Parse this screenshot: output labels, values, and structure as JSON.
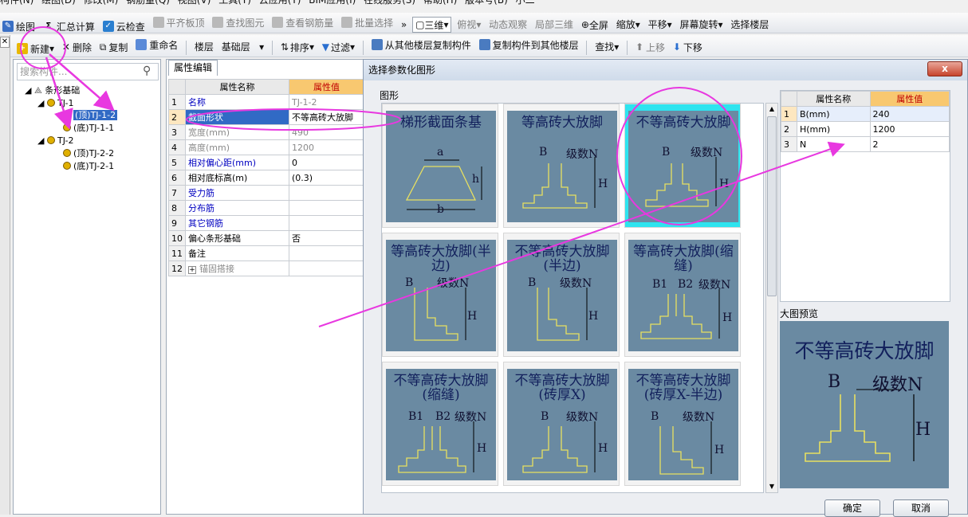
{
  "menubar": [
    "构件(N)",
    "绘图(D)",
    "修改(M)",
    "钢筋量(Q)",
    "视图(V)",
    "工具(T)",
    "云应用(Y)",
    "BIM应用(I)",
    "在线服务(S)",
    "帮助(H)",
    "版本号(B)",
    "小二"
  ],
  "toolbar1": {
    "draw": "绘图",
    "sum": "汇总计算",
    "cloud": "云检查",
    "flat": "平齐板顶",
    "find": "查找图元",
    "viewrebar": "查看钢筋量",
    "batch": "批量选择",
    "view3d": "三维",
    "top": "俯视",
    "dynamic": "动态观察",
    "local3d": "局部三维",
    "full": "全屏",
    "zoom": "缩放",
    "pan": "平移",
    "rotate": "屏幕旋转",
    "floor": "选择楼层"
  },
  "toolbar2": {
    "new": "新建",
    "delete": "删除",
    "copy": "复制",
    "rename": "重命名",
    "floor_label": "楼层",
    "floor_value": "基础层",
    "sort": "排序",
    "filter": "过滤",
    "copy_from": "从其他楼层复制构件",
    "copy_to": "复制构件到其他楼层",
    "find": "查找",
    "up": "上移",
    "down": "下移"
  },
  "tree": {
    "search_placeholder": "搜索构件...",
    "root": "条形基础",
    "n1": "TJ-1",
    "n1a": "(顶)TJ-1-2",
    "n1b": "(底)TJ-1-1",
    "n2": "TJ-2",
    "n2a": "(顶)TJ-2-2",
    "n2b": "(底)TJ-2-1"
  },
  "props": {
    "tab": "属性编辑",
    "col_name": "属性名称",
    "col_value": "属性值",
    "rows": [
      {
        "n": "1",
        "name": "名称",
        "value": "TJ-1-2"
      },
      {
        "n": "2",
        "name": "截面形状",
        "value": "不等高砖大放脚"
      },
      {
        "n": "3",
        "name": "宽度(mm)",
        "value": "490"
      },
      {
        "n": "4",
        "name": "高度(mm)",
        "value": "1200"
      },
      {
        "n": "5",
        "name": "相对偏心距(mm)",
        "value": "0"
      },
      {
        "n": "6",
        "name": "相对底标高(m)",
        "value": "(0.3)"
      },
      {
        "n": "7",
        "name": "受力筋",
        "value": ""
      },
      {
        "n": "8",
        "name": "分布筋",
        "value": ""
      },
      {
        "n": "9",
        "name": "其它钢筋",
        "value": ""
      },
      {
        "n": "10",
        "name": "偏心条形基础",
        "value": "否"
      },
      {
        "n": "11",
        "name": "备注",
        "value": ""
      },
      {
        "n": "12",
        "name": "锚固搭接",
        "value": ""
      }
    ]
  },
  "dialog": {
    "title": "选择参数化图形",
    "close": "x",
    "group": "图形",
    "shapes": [
      "梯形截面条基",
      "等高砖大放脚",
      "不等高砖大放脚",
      "等高砖大放脚(半边)",
      "不等高砖大放脚(半边)",
      "等高砖大放脚(缩缝)",
      "不等高砖大放脚(缩缝)",
      "不等高砖大放脚(砖厚X)",
      "不等高砖大放脚(砖厚X-半边)"
    ],
    "labels": {
      "a": "a",
      "b": "b",
      "h": "h",
      "B": "B",
      "H": "H",
      "N": "级数N",
      "B1": "B1",
      "B2": "B2"
    },
    "param_cols": {
      "name": "属性名称",
      "value": "属性值"
    },
    "params": [
      {
        "n": "1",
        "name": "B(mm)",
        "value": "240"
      },
      {
        "n": "2",
        "name": "H(mm)",
        "value": "1200"
      },
      {
        "n": "3",
        "name": "N",
        "value": "2"
      }
    ],
    "preview_label": "大图预览",
    "preview_title": "不等高砖大放脚",
    "ok": "确定",
    "cancel": "取消"
  },
  "colors": {
    "accent": "#e838e0",
    "thumb_bg": "#6a8aa2",
    "selected": "#2ee4ef",
    "header_value": "#f8c870"
  }
}
